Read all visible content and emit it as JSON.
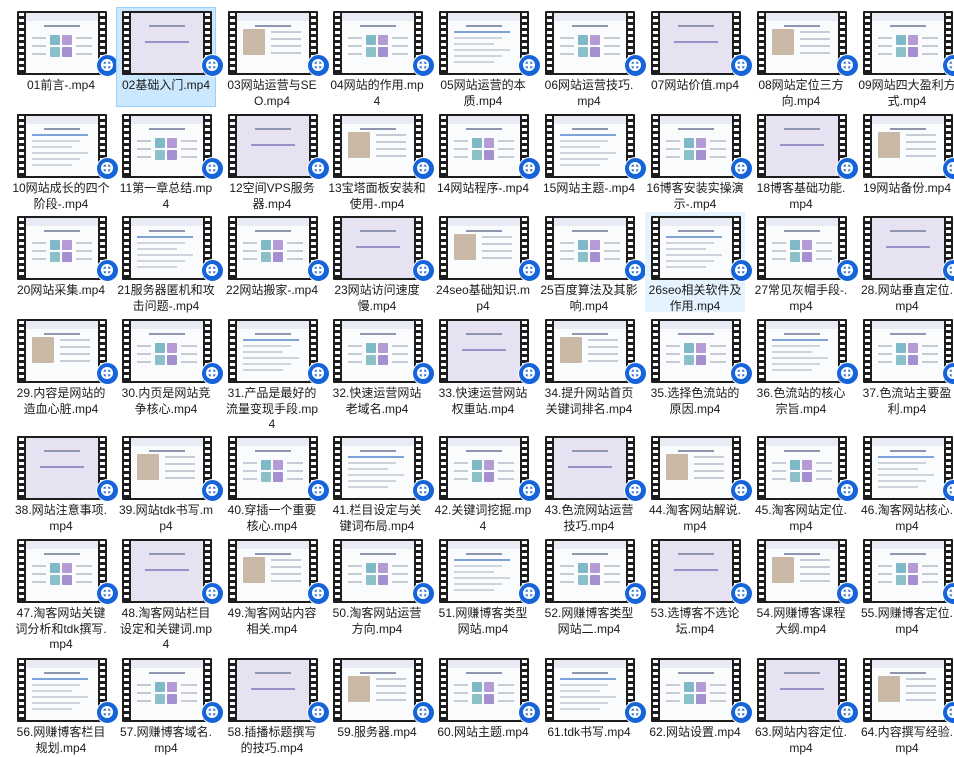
{
  "files": [
    "01前言-.mp4",
    "02基础入门.mp4",
    "03网站运营与SEO.mp4",
    "04网站的作用.mp4",
    "05网站运营的本质.mp4",
    "06网站运营技巧.mp4",
    "07网站价值.mp4",
    "08网站定位三方向.mp4",
    "09网站四大盈利方式.mp4",
    "10网站成长的四个阶段-.mp4",
    "11第一章总结.mp4",
    "12空间VPS服务器.mp4",
    "13宝塔面板安装和使用-.mp4",
    "14网站程序-.mp4",
    "15网站主题-.mp4",
    "16博客安装实操演示-.mp4",
    "18博客基础功能.mp4",
    "19网站备份.mp4",
    "20网站采集.mp4",
    "21服务器匿机和攻击问题-.mp4",
    "22网站搬家-.mp4",
    "23网站访问速度慢.mp4",
    "24seo基础知识.mp4",
    "25百度算法及其影响.mp4",
    "26seo相关软件及作用.mp4",
    "27常见灰帽手段-.mp4",
    "28.网站垂直定位.mp4",
    "29.内容是网站的造血心脏.mp4",
    "30.内页是网站竞争核心.mp4",
    "31.产品是最好的流量变现手段.mp4",
    "32.快速运营网站老域名.mp4",
    "33.快速运营网站权重站.mp4",
    "34.提升网站首页关键词排名.mp4",
    "35.选择色流站的原因.mp4",
    "36.色流站的核心宗旨.mp4",
    "37.色流站主要盈利.mp4",
    "38.网站注意事项.mp4",
    "39.网站tdk书写.mp4",
    "40.穿插一个重要核心.mp4",
    "41.栏目设定与关键词布局.mp4",
    "42.关键词挖掘.mp4",
    "43.色流网站运营技巧.mp4",
    "44.淘客网站解说.mp4",
    "45.淘客网站定位.mp4",
    "46.淘客网站核心.mp4",
    "47.淘客网站关键词分析和tdk撰写.mp4",
    "48.淘客网站栏目设定和关键词.mp4",
    "49.淘客网站内容相关.mp4",
    "50.淘客网站运营方向.mp4",
    "51.网赚博客类型网站.mp4",
    "52.网赚博客类型网站二.mp4",
    "53.选博客不选论坛.mp4",
    "54.网赚博客课程大纲.mp4",
    "55.网赚博客定位.mp4",
    "56.网赚博客栏目规划.mp4",
    "57.网赚博客域名.mp4",
    "58.插播标题撰写的技巧.mp4",
    "59.服务器.mp4",
    "60.网站主题.mp4",
    "61.tdk书写.mp4",
    "62.网站设置.mp4",
    "63.网站内容定位.mp4",
    "64.内容撰写经验.mp4"
  ],
  "selected_index": 1,
  "hover_index": 24,
  "colors": {
    "selection_bg": "#cce8ff",
    "selection_border": "#99d1ff",
    "hover_bg": "#e5f3ff",
    "badge": "#1664d9",
    "film": "#1d1d1d"
  },
  "thumb_icon": "media-player-icon"
}
